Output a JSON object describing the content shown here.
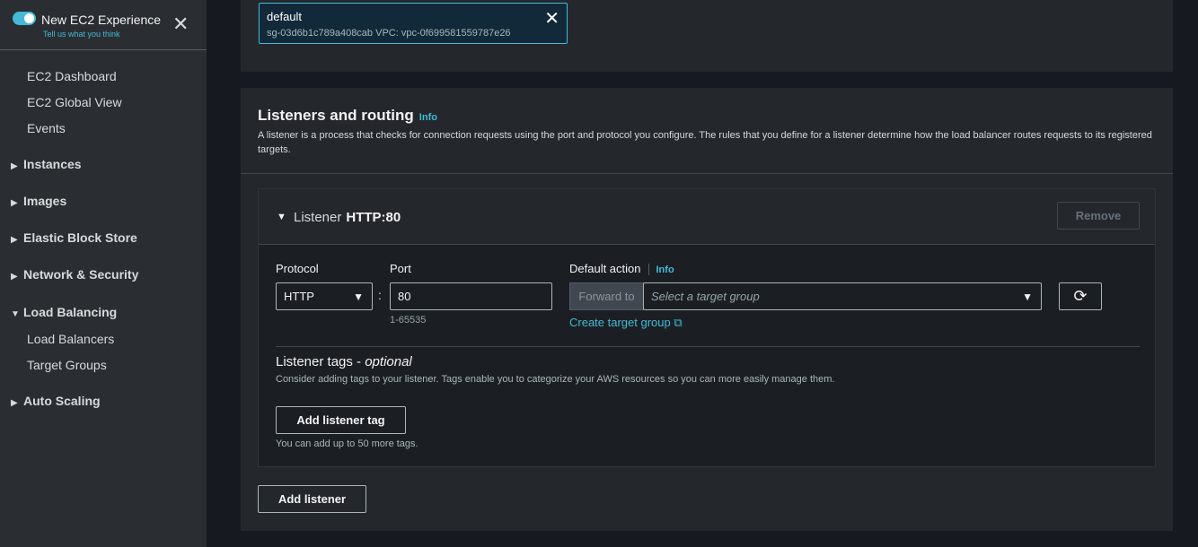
{
  "sidebar": {
    "experience_title": "New EC2 Experience",
    "experience_sub": "Tell us what you think",
    "items": [
      {
        "label": "EC2 Dashboard"
      },
      {
        "label": "EC2 Global View"
      },
      {
        "label": "Events"
      }
    ],
    "groups": [
      {
        "label": "Instances",
        "expanded": false
      },
      {
        "label": "Images",
        "expanded": false
      },
      {
        "label": "Elastic Block Store",
        "expanded": false
      },
      {
        "label": "Network & Security",
        "expanded": false
      },
      {
        "label": "Load Balancing",
        "expanded": true
      },
      {
        "label": "Auto Scaling",
        "expanded": false
      }
    ],
    "lb_items": [
      {
        "label": "Load Balancers"
      },
      {
        "label": "Target Groups"
      }
    ]
  },
  "security_group": {
    "name": "default",
    "meta": "sg-03d6b1c789a408cab    VPC: vpc-0f699581559787e26"
  },
  "listeners_section": {
    "title": "Listeners and routing",
    "info": "Info",
    "description": "A listener is a process that checks for connection requests using the port and protocol you configure. The rules that you define for a listener determine how the load balancer routes requests to its registered targets."
  },
  "listener": {
    "prefix": "Listener",
    "name": "HTTP:80",
    "remove_label": "Remove",
    "protocol_label": "Protocol",
    "protocol_value": "HTTP",
    "port_label": "Port",
    "port_value": "80",
    "port_hint": "1-65535",
    "default_action_label": "Default action",
    "default_action_info": "Info",
    "forward_label": "Forward to",
    "target_group_placeholder": "Select a target group",
    "create_target_group": "Create target group",
    "tags_title": "Listener tags - ",
    "tags_optional": "optional",
    "tags_description": "Consider adding tags to your listener. Tags enable you to categorize your AWS resources so you can more easily manage them.",
    "add_tag_label": "Add listener tag",
    "tags_hint": "You can add up to 50 more tags."
  },
  "add_listener_label": "Add listener",
  "colors": {
    "accent": "#44b9d6",
    "background": "#16191f",
    "panel": "#24282d"
  }
}
